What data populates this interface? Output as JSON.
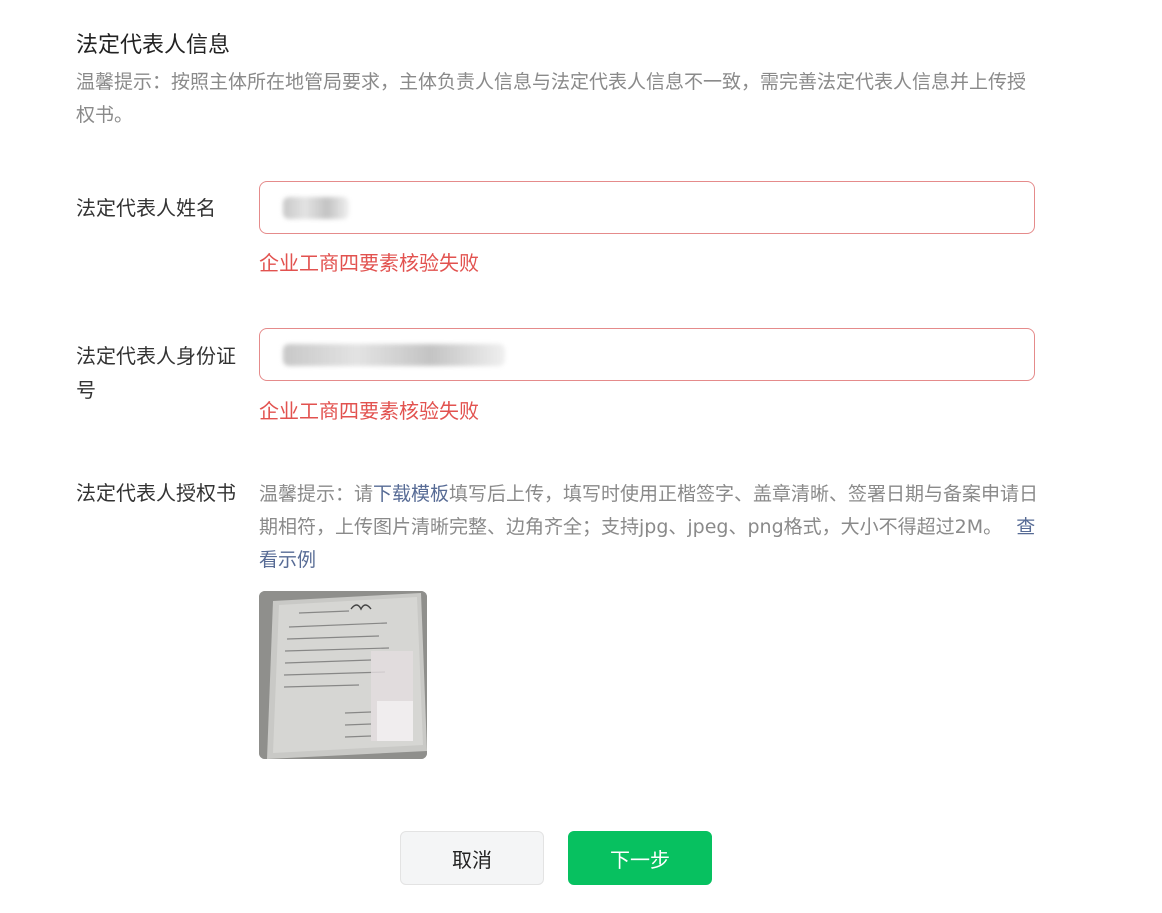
{
  "section": {
    "title": "法定代表人信息",
    "tip": "温馨提示：按照主体所在地管局要求，主体负责人信息与法定代表人信息不一致，需完善法定代表人信息并上传授权书。"
  },
  "fields": {
    "name": {
      "label": "法定代表人姓名",
      "value": "",
      "error": "企业工商四要素核验失败"
    },
    "id_number": {
      "label": "法定代表人身份证号",
      "value": "",
      "error": "企业工商四要素核验失败"
    },
    "authorization": {
      "label": "法定代表人授权书",
      "tip_prefix": "温馨提示：请",
      "download_link": "下载模板",
      "tip_suffix": "填写后上传，填写时使用正楷签字、盖章清晰、签署日期与备案申请日期相符，上传图片清晰完整、边角齐全；支持jpg、jpeg、png格式，大小不得超过2M。",
      "example_link": "查看示例"
    }
  },
  "buttons": {
    "cancel": "取消",
    "next": "下一步"
  },
  "colors": {
    "error": "#e2524f",
    "primary": "#07c160",
    "link": "#576b95",
    "tip": "#8a8a8a"
  }
}
